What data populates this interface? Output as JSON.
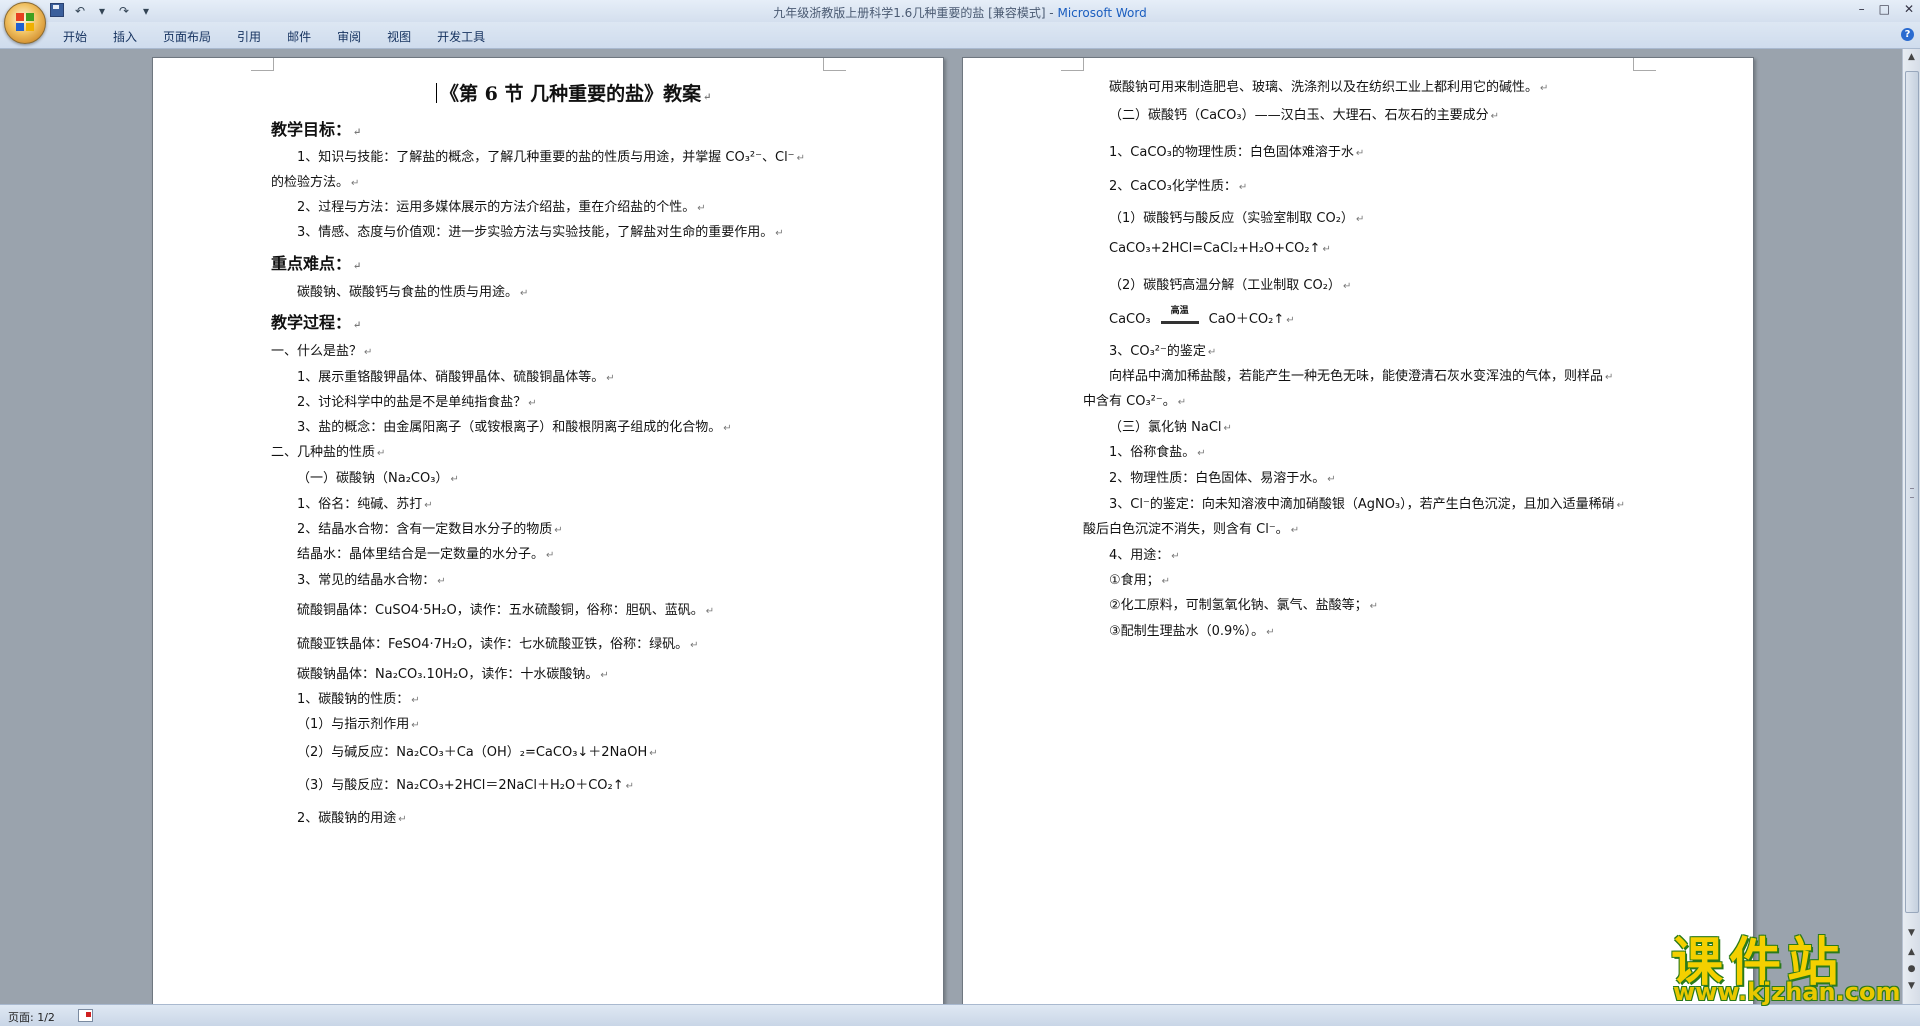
{
  "window": {
    "title": "九年级浙教版上册科学1.6几种重要的盐 [兼容模式] - ",
    "app_name": "Microsoft Word",
    "controls": [
      "–",
      "□",
      "✕"
    ]
  },
  "qat": {
    "save": "save-icon",
    "undo": "↶",
    "undo_dd": "▾",
    "redo": "↷",
    "customize": "▾"
  },
  "ribbon": {
    "tabs": [
      "开始",
      "插入",
      "页面布局",
      "引用",
      "邮件",
      "审阅",
      "视图",
      "开发工具"
    ],
    "help": "?"
  },
  "page1": {
    "lines": [
      {
        "text": "《第 6 节  几种重要的盐》教案",
        "style": "h1"
      },
      {
        "text": "教学目标：",
        "style": "h2"
      },
      {
        "text": "1、知识与技能：了解盐的概念，了解几种重要的盐的性质与用途，并掌握 CO₃²⁻、Cl⁻"
      },
      {
        "text": "的检验方法。"
      },
      {
        "text": "2、过程与方法：运用多媒体展示的方法介绍盐，重在介绍盐的个性。"
      },
      {
        "text": "3、情感、态度与价值观：进一步实验方法与实验技能，了解盐对生命的重要作用。"
      },
      {
        "text": "重点难点：",
        "style": "h2"
      },
      {
        "text": "碳酸钠、碳酸钙与食盐的性质与用途。"
      },
      {
        "text": "教学过程：",
        "style": "h2"
      },
      {
        "text": "一、什么是盐？"
      },
      {
        "text": "1、展示重铬酸钾晶体、硝酸钾晶体、硫酸铜晶体等。"
      },
      {
        "text": "2、讨论科学中的盐是不是单纯指食盐？"
      },
      {
        "text": "3、盐的概念：由金属阳离子（或铵根离子）和酸根阴离子组成的化合物。"
      },
      {
        "text": "二、几种盐的性质"
      },
      {
        "text": "（一）碳酸钠（Na₂CO₃）"
      },
      {
        "text": "1、俗名：纯碱、苏打"
      },
      {
        "text": "2、结晶水合物：含有一定数目水分子的物质"
      },
      {
        "text": "结晶水：晶体里结合是一定数量的水分子。"
      },
      {
        "text": "3、常见的结晶水合物："
      },
      {
        "text": "硫酸铜晶体：CuSO4·5H₂O，读作：五水硫酸铜，俗称：胆矾、蓝矾。"
      },
      {
        "text": "硫酸亚铁晶体：FeSO4·7H₂O，读作：七水硫酸亚铁，俗称：绿矾。"
      },
      {
        "text": "碳酸钠晶体：Na₂CO₃.10H₂O，读作：十水碳酸钠。"
      },
      {
        "text": "1、碳酸钠的性质："
      },
      {
        "text": "（1）与指示剂作用"
      },
      {
        "text": "（2）与碱反应：Na₂CO₃＋Ca（OH）₂=CaCO₃↓＋2NaOH"
      },
      {
        "text": "（3）与酸反应：Na₂CO₃+2HCl＝2NaCl＋H₂O＋CO₂↑"
      },
      {
        "text": "2、碳酸钠的用途"
      }
    ]
  },
  "page2": {
    "lines": [
      {
        "text": "碳酸钠可用来制造肥皂、玻璃、洗涤剂以及在纺织工业上都利用它的碱性。"
      },
      {
        "text": "（二）碳酸钙（CaCO₃）——汉白玉、大理石、石灰石的主要成分"
      },
      {
        "text": "1、CaCO₃的物理性质：白色固体难溶于水"
      },
      {
        "text": "2、CaCO₃化学性质："
      },
      {
        "text": "（1）碳酸钙与酸反应（实验室制取 CO₂）"
      },
      {
        "text": "CaCO₃+2HCl=CaCl₂+H₂O+CO₂↑"
      },
      {
        "text": "（2）碳酸钙高温分解（工业制取 CO₂）"
      },
      {
        "text": "",
        "reaction": {
          "left": "CaCO₃",
          "condition": "高温",
          "right": "CaO＋CO₂↑"
        }
      },
      {
        "text": "3、CO₃²⁻的鉴定"
      },
      {
        "text": "向样品中滴加稀盐酸，若能产生一种无色无味，能使澄清石灰水变浑浊的气体，则样品"
      },
      {
        "text": "中含有 CO₃²⁻。"
      },
      {
        "text": "（三）氯化钠 NaCl"
      },
      {
        "text": "1、俗称食盐。"
      },
      {
        "text": "2、物理性质：白色固体、易溶于水。"
      },
      {
        "text": "3、Cl⁻的鉴定：向未知溶液中滴加硝酸银（AgNO₃），若产生白色沉淀，且加入适量稀硝"
      },
      {
        "text": "酸后白色沉淀不消失，则含有 Cl⁻。"
      },
      {
        "text": "4、用途："
      },
      {
        "text": "①食用；"
      },
      {
        "text": "②化工原料，可制氢氧化钠、氯气、盐酸等；"
      },
      {
        "text": "③配制生理盐水（0.9%）。"
      }
    ]
  },
  "marks": {
    "paragraph": "↵"
  },
  "statusbar": {
    "page": "页面: 1/2"
  },
  "watermark": {
    "text": "课件站",
    "url": "www.kjzhan.com"
  },
  "scrollbar": {
    "up": "▲",
    "down": "▼",
    "prev": "▲",
    "select": "●",
    "next": "▼"
  },
  "colors": {
    "app_name": "#1a5dbf",
    "workspace": "#9aa3ad",
    "watermark_text": "#f4d000",
    "watermark_outline": "#2a7a1a"
  }
}
